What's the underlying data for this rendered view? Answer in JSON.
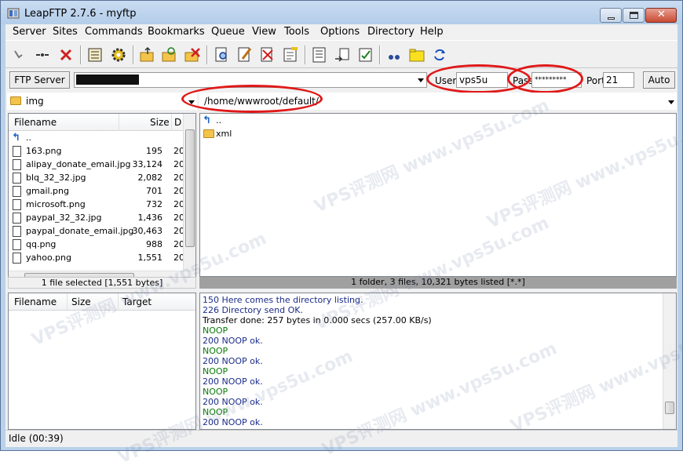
{
  "window": {
    "title": "LeapFTP 2.7.6 - myftp"
  },
  "menu": [
    "Server",
    "Sites",
    "Commands",
    "Bookmarks",
    "Queue",
    "View",
    "Tools",
    "Options",
    "Directory",
    "Help"
  ],
  "toolbar": {
    "icons": [
      "connect-icon",
      "disconnect-link-icon",
      "cancel-x-icon",
      "site-manager-book-icon",
      "settings-gear-icon",
      "folder-upload-icon",
      "folder-refresh-icon",
      "folder-delete-icon",
      "search-file-icon",
      "edit-pencil-icon",
      "delete-file-icon",
      "properties-icon",
      "queue-list-icon",
      "transfer-icon",
      "checklist-icon",
      "binoculars-icon",
      "open-folder-icon",
      "sync-icon"
    ]
  },
  "connection": {
    "server_button": "FTP Server",
    "host_value": "",
    "user_label": "User",
    "user_value": "vps5u",
    "pass_label": "Pass",
    "pass_value": "*********",
    "port_label": "Port",
    "port_value": "21",
    "auto_button": "Auto"
  },
  "local": {
    "folder": "img",
    "columns": {
      "name": "Filename",
      "size": "Size",
      "date": "D"
    },
    "parent": "..",
    "files": [
      {
        "name": "163.png",
        "size": "195",
        "date": "20"
      },
      {
        "name": "alipay_donate_email.jpg",
        "size": "33,124",
        "date": "20"
      },
      {
        "name": "blq_32_32.jpg",
        "size": "2,082",
        "date": "20"
      },
      {
        "name": "gmail.png",
        "size": "701",
        "date": "20"
      },
      {
        "name": "microsoft.png",
        "size": "732",
        "date": "20"
      },
      {
        "name": "paypal_32_32.jpg",
        "size": "1,436",
        "date": "20"
      },
      {
        "name": "paypal_donate_email.jpg",
        "size": "30,463",
        "date": "20"
      },
      {
        "name": "qq.png",
        "size": "988",
        "date": "20"
      },
      {
        "name": "yahoo.png",
        "size": "1,551",
        "date": "20"
      }
    ],
    "status": "1 file selected [1,551 bytes]"
  },
  "remote": {
    "path": "/home/wwwroot/default/",
    "parent": "..",
    "items": [
      {
        "name": "xml"
      }
    ],
    "status": "1 folder, 3 files, 10,321 bytes listed [*.*]"
  },
  "queue": {
    "columns": {
      "name": "Filename",
      "size": "Size",
      "target": "Target"
    }
  },
  "log": {
    "lines": [
      {
        "text": "150 Here comes the directory listing.",
        "type": "reply"
      },
      {
        "text": "226 Directory send OK.",
        "type": "reply"
      },
      {
        "text": "Transfer done: 257 bytes in 0.000 secs (257.00 KB/s)",
        "type": "info"
      },
      {
        "text": "NOOP",
        "type": "cmd"
      },
      {
        "text": "200 NOOP ok.",
        "type": "reply"
      },
      {
        "text": "NOOP",
        "type": "cmd"
      },
      {
        "text": "200 NOOP ok.",
        "type": "reply"
      },
      {
        "text": "NOOP",
        "type": "cmd"
      },
      {
        "text": "200 NOOP ok.",
        "type": "reply"
      },
      {
        "text": "NOOP",
        "type": "cmd"
      },
      {
        "text": "200 NOOP ok.",
        "type": "reply"
      },
      {
        "text": "NOOP",
        "type": "cmd"
      },
      {
        "text": "200 NOOP ok.",
        "type": "reply"
      }
    ]
  },
  "status_bar": {
    "text": "Idle (00:39)"
  },
  "watermarks": [
    "VPS评测网 www.vps5u.com"
  ],
  "colors": {
    "titlebar": "#b9d1ea",
    "highlight_ellipse": "#e01818",
    "status_gray": "#a0a0a0",
    "log_green": "#0a7a0a",
    "log_blue": "#1a2c8a"
  }
}
